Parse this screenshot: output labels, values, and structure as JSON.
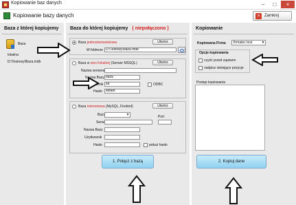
{
  "window": {
    "title": "Kopiowanie baz danych"
  },
  "header": {
    "title": "Kopiowanie bazy danych",
    "close_label": "Zamknij"
  },
  "left_panel": {
    "title": "Baza z której kopiujemy",
    "db_name": "Baza",
    "location_label": "lokalna",
    "location_path": "D:\\Testowy\\Baza.mdb"
  },
  "mid_panel": {
    "title": "Baza do której kopiujemy",
    "status": "( niepołączono )",
    "local": {
      "radio_label_a": "Baza",
      "radio_label_b": "jednostanowiskowa",
      "create_button": "Utwórz",
      "file_label": "W folderze",
      "file_value": "D:\\Testowy\\baza.mdb"
    },
    "network": {
      "radio_label_a": "Baza w",
      "radio_label_b": "sieci lokalnej",
      "radio_label_c": "(Serwer MSSQL)",
      "create_button": "Utwórz",
      "server_label": "Nazwa serwera",
      "server_value": "",
      "db_label": "Nazwa Bazy",
      "db_value": "baza",
      "user_label": "Użytkownik",
      "user_value": "sa",
      "pass_label": "Hasło",
      "pass_value": "Mitaet",
      "odbc_label": "ODBC"
    },
    "internet": {
      "radio_label_a": "Baza",
      "radio_label_b": "internetowa",
      "radio_label_c": "(MySQL, Firebird)",
      "create_button": "Utwórz",
      "type_label": "Baza",
      "server_label": "Serwer",
      "port_label": "Port",
      "db_label": "Nazwa Bazy",
      "user_label": "Użytkownik",
      "pass_label": "Hasło",
      "show_pass_label": "pokaż hasło"
    },
    "connect_button": "1. Połącz z bazą"
  },
  "right_panel": {
    "title": "Kopiowanie",
    "company_label": "Kopiowana Firma",
    "company_value": "firmatec test",
    "options_title": "Opcje kopiowania",
    "option_clear": "czyść przed zapisem",
    "option_overwrite": "nadpisz istniejące pozycje",
    "progress_label": "Postęp kopiowania",
    "copy_button": "2. Kopiuj dane"
  },
  "icons": {
    "arrow_color": "#111111",
    "title_icon": "app-icon",
    "header_icon": "database-icon"
  }
}
